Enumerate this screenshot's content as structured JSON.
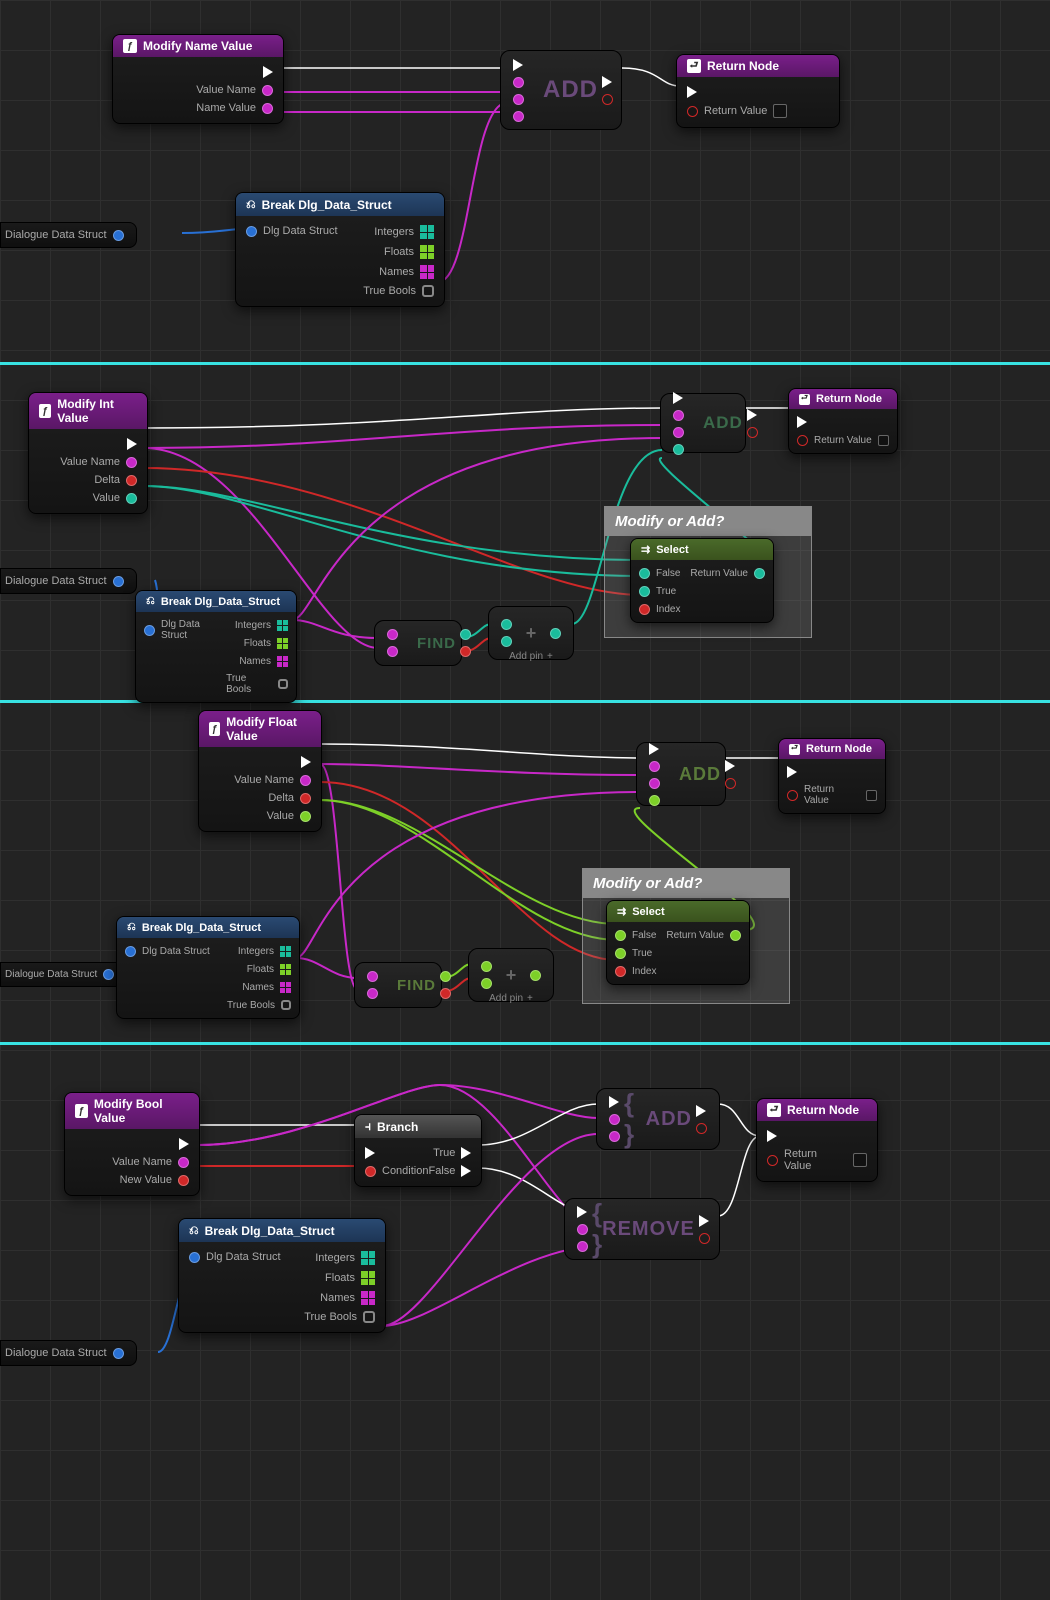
{
  "labels": {
    "modify_name": "Modify Name Value",
    "modify_int": "Modify Int Value",
    "modify_float": "Modify Float Value",
    "modify_bool": "Modify Bool Value",
    "return_node": "Return Node",
    "break_struct": "Break Dlg_Data_Struct",
    "branch": "Branch",
    "select": "Select",
    "add": "ADD",
    "find": "FIND",
    "remove": "REMOVE",
    "value_name": "Value Name",
    "name_value": "Name Value",
    "new_value": "New Value",
    "delta": "Delta",
    "value": "Value",
    "return_value": "Return Value",
    "dlg_data_struct": "Dlg Data Struct",
    "dialogue_data_struct": "Dialogue Data Struct",
    "integers": "Integers",
    "floats": "Floats",
    "names": "Names",
    "true_bools": "True Bools",
    "modify_or_add": "Modify or Add?",
    "false": "False",
    "true": "True",
    "index": "Index",
    "condition": "Condition",
    "add_pin": "Add pin"
  },
  "colors": {
    "exec": "#ffffff",
    "name": "#c828c8",
    "struct": "#2870d4",
    "int": "#1abc9c",
    "float": "#7dd028",
    "bool": "#d02828"
  }
}
